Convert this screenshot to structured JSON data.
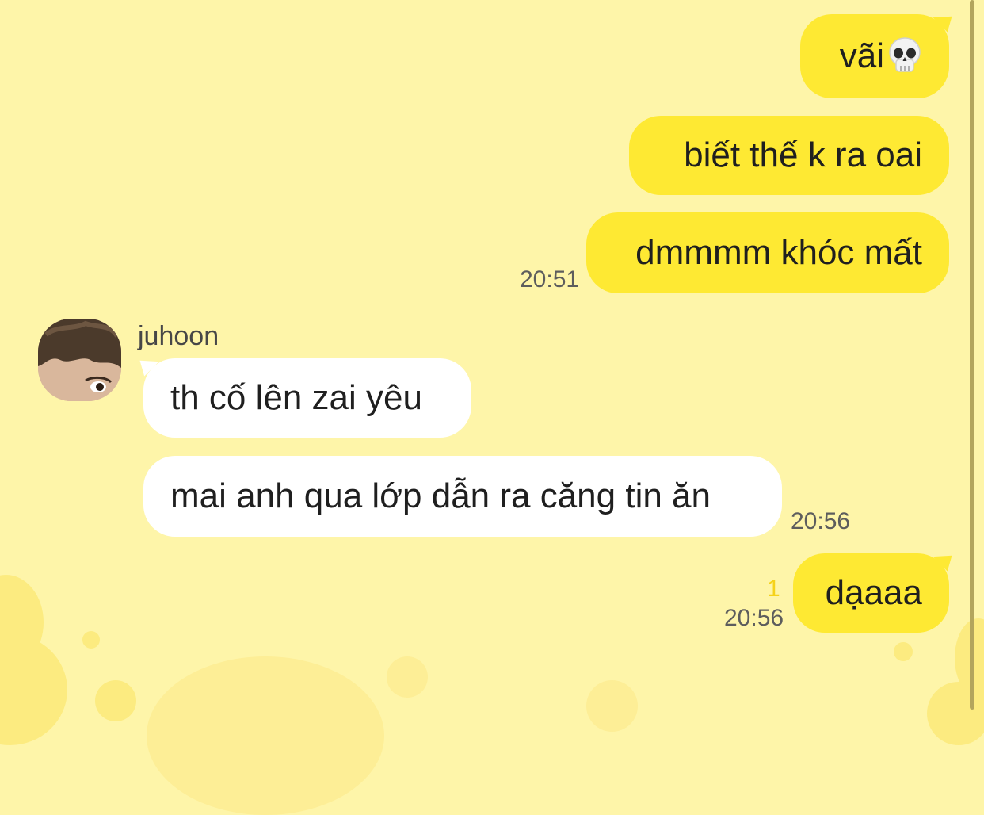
{
  "colors": {
    "background": "#FEF5A9",
    "outgoing_bubble": "#FEE933",
    "incoming_bubble": "#FFFFFF",
    "unread_indicator": "#F5D21A"
  },
  "messages": {
    "out_1": {
      "text": "vãi",
      "emoji": "skull"
    },
    "out_2": {
      "text": "biết thế k ra oai"
    },
    "out_3": {
      "text": "dmmmm khóc mất",
      "time": "20:51"
    },
    "in_group": {
      "sender": "juhoon",
      "avatar": "profile-photo",
      "in_1": {
        "text": "th cố lên zai yêu"
      },
      "in_2": {
        "text": "mai anh qua lớp dẫn ra căng tin ăn",
        "time": "20:56"
      }
    },
    "out_4": {
      "text": "dạaaa",
      "time": "20:56",
      "unread": "1"
    }
  }
}
